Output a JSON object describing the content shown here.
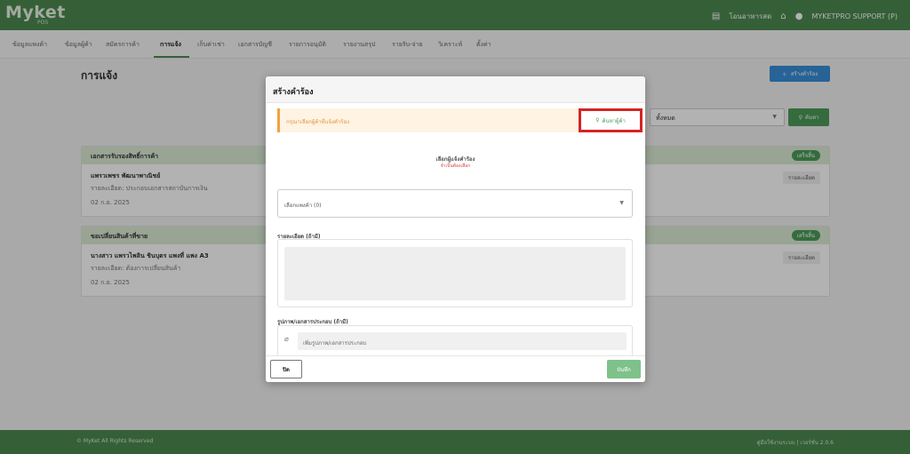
{
  "app": {
    "logo": "Myket",
    "logo_sub": "POS",
    "user_links": [
      {
        "icon": "store-icon",
        "label": "โอนอาหารสด"
      },
      {
        "icon": "home-icon",
        "label": ""
      },
      {
        "icon": "user-icon",
        "label": "MYKETPRO SUPPORT (P)"
      }
    ]
  },
  "nav": {
    "items": [
      "ข้อมูลแพงค้า",
      "ข้อมูลผู้ค้า",
      "สมัครการค้า",
      "การแจ้ง",
      "เก็บค่าเช่า",
      "เอกสารบัญชี",
      "รายการอนุมัติ",
      "รายงานสรุป",
      "รายรับ-จ่าย",
      "วิเคราะห์",
      "ตั้งค่า"
    ],
    "active_index": 3
  },
  "page": {
    "title": "การแจ้ง",
    "create_label": "สร้างคำร้อง",
    "filter_value": "ทั้งหมด",
    "search_label": "ค้นหา"
  },
  "cards": [
    {
      "category": "เอกสารรับรองสิทธิ์การค้า",
      "status": "เสร็จสิ้น",
      "name": "แพรวเพชร พัฒนาพาณิชย์",
      "detail": "รายละเอียด: ประกอบเอกสารสถาบันการเงิน",
      "date": "02 ก.ย. 2025",
      "detail_btn": "รายละเอียด"
    },
    {
      "category": "ขอเปลี่ยนสินค้าที่ขาย",
      "status": "เสร็จสิ้น",
      "name": "นางสาว แพรวไพลิน ชินบุตร แพงที่ แพง A3",
      "detail": "รายละเอียด: ต้องการเปลี่ยนสินค้า",
      "date": "02 ก.ย. 2025",
      "detail_btn": "รายละเอียด"
    }
  ],
  "footer": {
    "left": "© MyKet All Rights Reserved",
    "right": "คู่มือใช้งานระบบ | เวอร์ชั่น 2.0.6"
  },
  "modal": {
    "title": "สร้างคำร้อง",
    "warning": "กรุณาเลือกผู้ค้าที่แจ้งคำร้อง",
    "find_label": "ค้นหาผู้ค้า",
    "select_label": "เลือกผู้แจ้งคำร้อง",
    "select_required": "จำเป็นต้องเลือก",
    "branch_placeholder": "เลือกแพงค้า (0)",
    "detail_label": "รายละเอียด (ถ้ามี)",
    "attach_label": "รูปภาพ/เอกสารประกอบ (ถ้ามี)",
    "attach_placeholder": "เพิ่มรูปภาพ/เอกสารประกอบ",
    "close_label": "ปิด",
    "save_label": "บันทึก"
  },
  "colors": {
    "brand": "#4c8a4f",
    "primary": "#3a8fd8",
    "highlight": "#d42424",
    "warning": "#f0a340"
  }
}
